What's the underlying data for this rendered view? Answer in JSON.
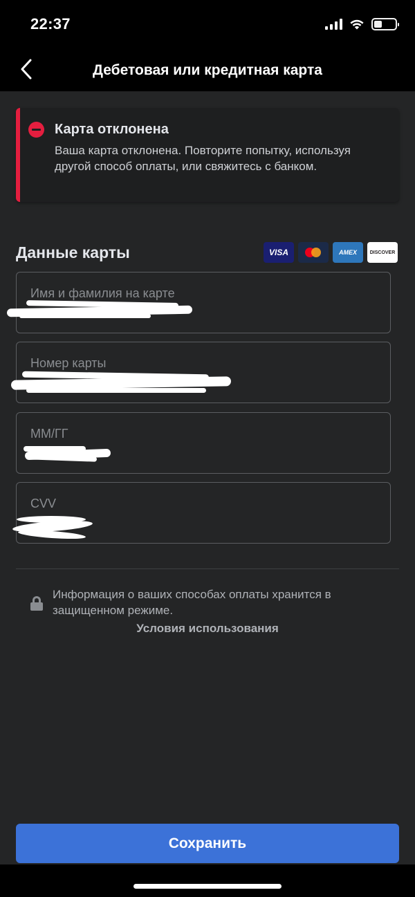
{
  "status_bar": {
    "time": "22:37"
  },
  "header": {
    "title": "Дебетовая или кредитная карта",
    "back_icon": "chevron-left-icon"
  },
  "alert": {
    "title": "Карта отклонена",
    "message": "Ваша карта отклонена. Повторите попытку, используя другой способ оплаты, или свяжитесь с банком.",
    "icon": "error-icon",
    "accent_color": "#e41e3f"
  },
  "card_section": {
    "title": "Данные карты",
    "logos": [
      "VISA",
      "mastercard",
      "AMEX",
      "DISCOVER"
    ]
  },
  "fields": {
    "name_label": "Имя и фамилия на карте",
    "number_label": "Номер карты",
    "expiry_label": "ММ/ГГ",
    "cvv_label": "CVV"
  },
  "info": {
    "text": "Информация о ваших способах оплаты хранится в защищенном режиме.",
    "terms_link": "Условия использования",
    "icon": "lock-icon"
  },
  "actions": {
    "save_label": "Сохранить",
    "save_color": "#3c72d8"
  }
}
